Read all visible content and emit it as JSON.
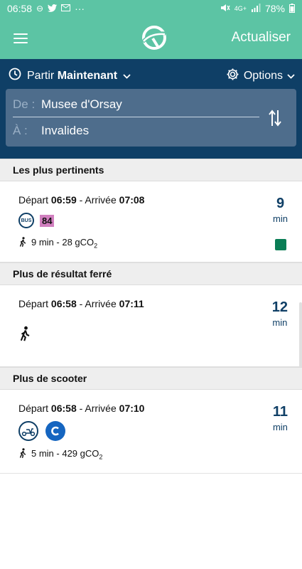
{
  "status": {
    "time": "06:58",
    "dots": "···",
    "network": "4G+",
    "battery": "78%"
  },
  "appbar": {
    "refresh_label": "Actualiser"
  },
  "trip": {
    "depart_prefix": "Partir",
    "depart_value": "Maintenant",
    "options_label": "Options",
    "from_label": "De :",
    "from_value": "Musee d'Orsay",
    "to_label": "À :",
    "to_value": "Invalides"
  },
  "sections": [
    {
      "title": "Les plus pertinents",
      "card": {
        "depart_label": "Départ",
        "depart_time": "06:59",
        "sep": " - ",
        "arrive_label": "Arrivée",
        "arrive_time": "07:08",
        "duration": "9",
        "duration_unit": "min",
        "mode": "bus",
        "line": "84",
        "walk_info": "9 min - 28 gCO",
        "co2_sub": "2"
      }
    },
    {
      "title": "Plus de résultat ferré",
      "card": {
        "depart_label": "Départ",
        "depart_time": "06:58",
        "sep": " - ",
        "arrive_label": "Arrivée",
        "arrive_time": "07:11",
        "duration": "12",
        "duration_unit": "min",
        "mode": "walk"
      }
    },
    {
      "title": "Plus de scooter",
      "card": {
        "depart_label": "Départ",
        "depart_time": "06:58",
        "sep": " - ",
        "arrive_label": "Arrivée",
        "arrive_time": "07:10",
        "duration": "11",
        "duration_unit": "min",
        "mode": "scooter",
        "walk_info": "5 min - 429 gCO",
        "co2_sub": "2"
      }
    }
  ],
  "colors": {
    "header_green": "#5cc4a4",
    "navy": "#0f3f66",
    "route_box": "#4e6d8c",
    "line84": "#d17fbf",
    "status_square": "#0a7d55",
    "scooter_blue": "#1565c0"
  }
}
